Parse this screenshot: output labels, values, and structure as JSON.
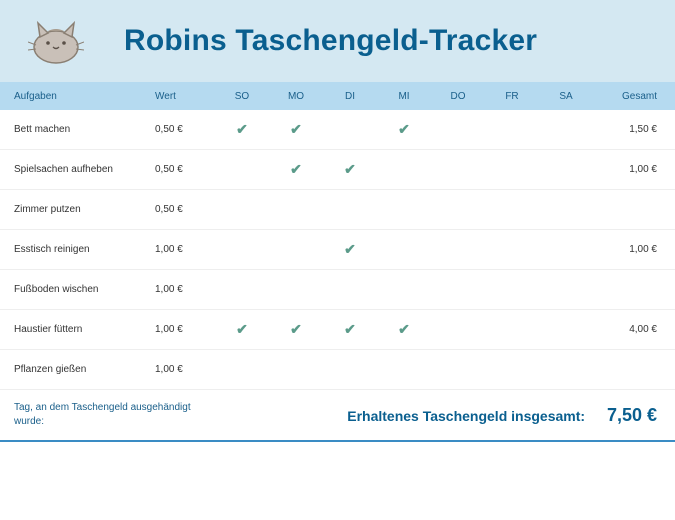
{
  "title": "Robins Taschengeld-Tracker",
  "columns": {
    "task": "Aufgaben",
    "value": "Wert",
    "days": [
      "SO",
      "MO",
      "DI",
      "MI",
      "DO",
      "FR",
      "SA"
    ],
    "total": "Gesamt"
  },
  "rows": [
    {
      "task": "Bett machen",
      "value": "0,50 €",
      "checks": [
        true,
        true,
        false,
        true,
        false,
        false,
        false
      ],
      "total": "1,50 €"
    },
    {
      "task": "Spielsachen aufheben",
      "value": "0,50 €",
      "checks": [
        false,
        true,
        true,
        false,
        false,
        false,
        false
      ],
      "total": "1,00 €"
    },
    {
      "task": "Zimmer putzen",
      "value": "0,50 €",
      "checks": [
        false,
        false,
        false,
        false,
        false,
        false,
        false
      ],
      "total": ""
    },
    {
      "task": "Esstisch reinigen",
      "value": "1,00 €",
      "checks": [
        false,
        false,
        true,
        false,
        false,
        false,
        false
      ],
      "total": "1,00 €"
    },
    {
      "task": "Fußboden wischen",
      "value": "1,00 €",
      "checks": [
        false,
        false,
        false,
        false,
        false,
        false,
        false
      ],
      "total": ""
    },
    {
      "task": "Haustier füttern",
      "value": "1,00 €",
      "checks": [
        true,
        true,
        true,
        true,
        false,
        false,
        false
      ],
      "total": "4,00 €"
    },
    {
      "task": "Pflanzen gießen",
      "value": "1,00 €",
      "checks": [
        false,
        false,
        false,
        false,
        false,
        false,
        false
      ],
      "total": ""
    }
  ],
  "footer": {
    "paid_day_label": "Tag, an dem Taschengeld ausgehändigt wurde:",
    "total_label": "Erhaltenes Taschengeld insgesamt:",
    "total_value": "7,50 €"
  },
  "checkmark": "✔"
}
